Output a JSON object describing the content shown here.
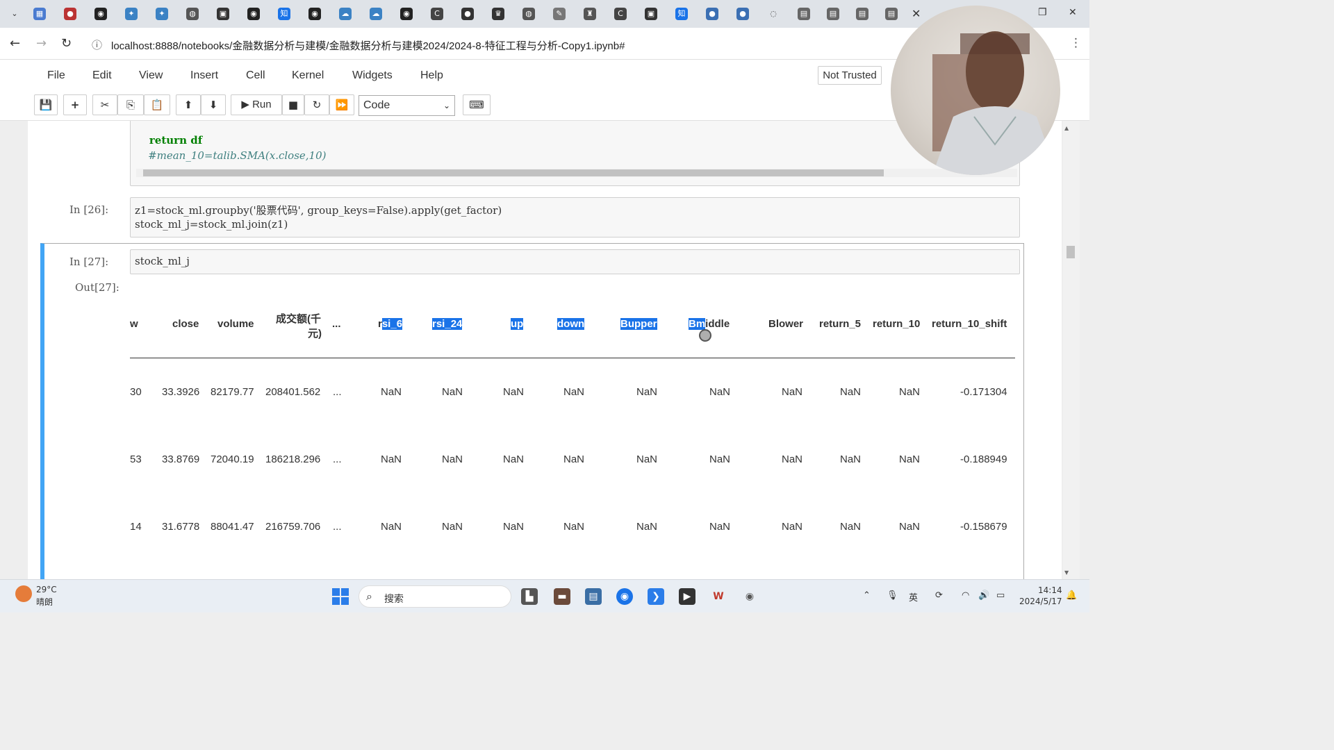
{
  "browser": {
    "address": "localhost:8888/notebooks/金融数据分析与建模/金融数据分析与建模2024/2024-8-特征工程与分析-Copy1.ipynb#",
    "tab_close": "✕"
  },
  "menu": {
    "items": [
      "File",
      "Edit",
      "View",
      "Insert",
      "Cell",
      "Kernel",
      "Widgets",
      "Help"
    ],
    "trust_label": "Not Trusted"
  },
  "toolbar": {
    "run_label": "Run",
    "cell_type": "Code"
  },
  "cells": {
    "prev_code_line1": "    return df",
    "prev_code_line2": "    #mean_10=talib.SMA(x.close,10)",
    "c26_prompt": "In  [26]:",
    "c26_line1": "z1=stock_ml.groupby('股票代码', group_keys=False).apply(get_factor)",
    "c26_line2": "stock_ml_j=stock_ml.join(z1)",
    "c27_prompt": "In  [27]:",
    "c27_code": "stock_ml_j",
    "out27_prompt": "Out[27]:"
  },
  "dataframe": {
    "headers": [
      "w",
      "close",
      "volume",
      "成交额(千",
      "元)",
      "...",
      "rsi_6",
      "rsi_24",
      "up",
      "down",
      "Bupper",
      "Bmiddle",
      "Blower",
      "return_5",
      "return_10",
      "return_10_shift"
    ],
    "rows": [
      [
        "30",
        "33.3926",
        "82179.77",
        "208401.562",
        "...",
        "NaN",
        "NaN",
        "NaN",
        "NaN",
        "NaN",
        "NaN",
        "NaN",
        "NaN",
        "NaN",
        "-0.171304"
      ],
      [
        "53",
        "33.8769",
        "72040.19",
        "186218.296",
        "...",
        "NaN",
        "NaN",
        "NaN",
        "NaN",
        "NaN",
        "NaN",
        "NaN",
        "NaN",
        "NaN",
        "-0.188949"
      ],
      [
        "14",
        "31.6778",
        "88041.47",
        "216759.706",
        "...",
        "NaN",
        "NaN",
        "NaN",
        "NaN",
        "NaN",
        "NaN",
        "NaN",
        "NaN",
        "NaN",
        "-0.158679"
      ]
    ]
  },
  "taskbar": {
    "weather_temp": "29°C",
    "weather_desc": "晴朗",
    "search_placeholder": "搜索",
    "time": "14:14",
    "date": "2024/5/17"
  },
  "colors": {
    "accent": "#1a73e8",
    "cell_selected_bar": "#42a5f5"
  }
}
